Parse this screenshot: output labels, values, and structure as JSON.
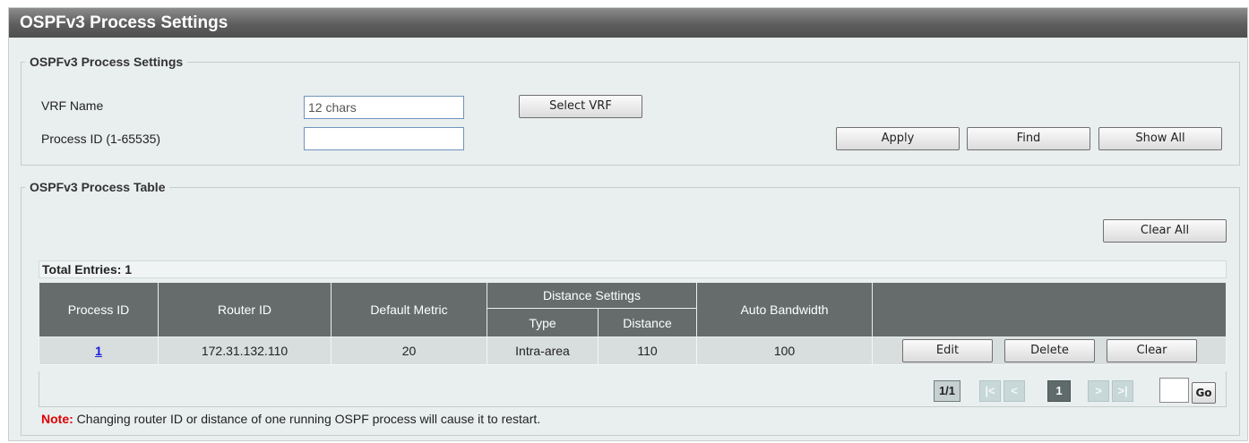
{
  "page": {
    "title": "OSPFv3 Process Settings"
  },
  "settings": {
    "legend": "OSPFv3 Process Settings",
    "vrf_label": "VRF Name",
    "vrf_value": "12 chars",
    "select_vrf_label": "Select VRF",
    "process_id_label": "Process ID (1-65535)",
    "process_id_value": "",
    "apply_label": "Apply",
    "find_label": "Find",
    "show_all_label": "Show All"
  },
  "table_section": {
    "legend": "OSPFv3 Process Table",
    "clear_all_label": "Clear All",
    "total_entries": "Total Entries: 1",
    "headers": {
      "process_id": "Process ID",
      "router_id": "Router ID",
      "default_metric": "Default Metric",
      "distance_settings": "Distance Settings",
      "type": "Type",
      "distance": "Distance",
      "auto_bandwidth": "Auto Bandwidth"
    },
    "rows": [
      {
        "process_id": "1",
        "router_id": "172.31.132.110",
        "default_metric": "20",
        "type": "Intra-area",
        "distance": "110",
        "auto_bandwidth": "100",
        "edit_label": "Edit",
        "delete_label": "Delete",
        "clear_label": "Clear"
      }
    ]
  },
  "pagination": {
    "page_info": "1/1",
    "first": "|<",
    "prev": "<",
    "current": "1",
    "next": ">",
    "last": ">|",
    "go_value": "",
    "go_label": "Go"
  },
  "note": {
    "prefix": "Note:",
    "text": " Changing router ID or distance of one running OSPF process will cause it to restart."
  }
}
